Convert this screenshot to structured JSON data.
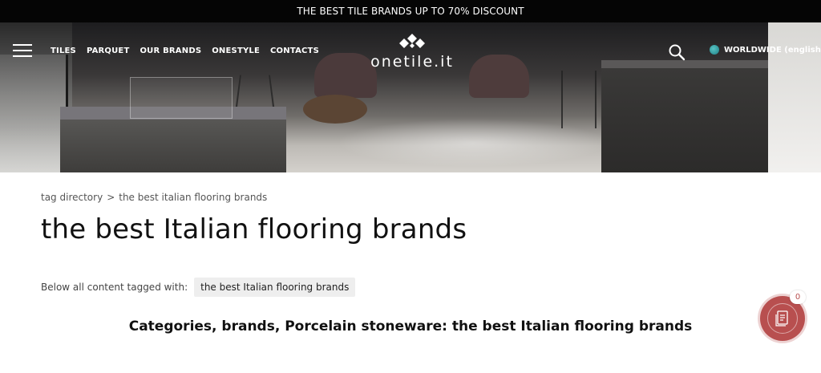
{
  "promo": {
    "text": "THE BEST TILE BRANDS UP TO 70% DISCOUNT"
  },
  "header": {
    "menu_items": [
      {
        "label": "TILES"
      },
      {
        "label": "PARQUET"
      },
      {
        "label": "OUR BRANDS"
      },
      {
        "label": "ONESTYLE"
      },
      {
        "label": "CONTACTS"
      }
    ],
    "logo_text": "onetile.it",
    "language_label": "WORLDWIDE (english)",
    "icons": {
      "menu": "hamburger-menu-icon",
      "search": "search-icon",
      "globe": "globe-icon",
      "logo": "onetile-logo-icon"
    }
  },
  "breadcrumb": {
    "root": "tag directory",
    "separator": ">",
    "current": "the best italian flooring brands"
  },
  "page": {
    "title": "the best Italian flooring brands",
    "tag_intro": "Below all content tagged with:",
    "tag_label": "the best Italian flooring brands",
    "section_heading": "Categories, brands, Porcelain stoneware: the best Italian flooring brands"
  },
  "cart": {
    "count": "0",
    "icon": "cart-list-icon",
    "color": "#b84f4f"
  }
}
